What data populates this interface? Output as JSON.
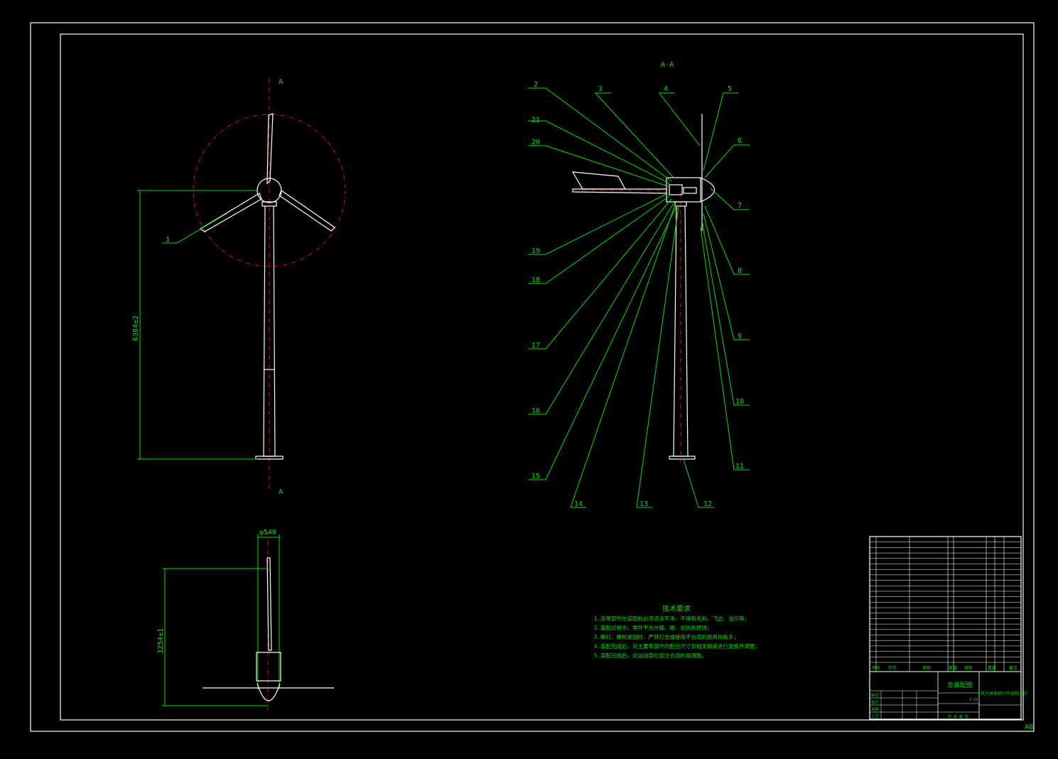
{
  "drawing": {
    "section_marker": "A",
    "section_title": "A-A",
    "sheet_size": "A0",
    "front_dim": "6384±2",
    "top_dim_diameter": "φ540",
    "top_dim_length": "3254±1",
    "front_callout": "1",
    "callouts_right": [
      "5",
      "6",
      "7",
      "8",
      "9",
      "10",
      "11"
    ],
    "callouts_left": [
      "2",
      "21",
      "20",
      "19",
      "18",
      "17",
      "16",
      "15"
    ],
    "callouts_top": [
      "3",
      "4"
    ],
    "callouts_bottom": [
      "14",
      "13",
      "12"
    ]
  },
  "notes": {
    "title": "技术要求",
    "lines": [
      "1.各零部件在装配前必须清洗干净，不得有毛刺、飞边、油污等；",
      "2.装配过程中，零件不允许磕、碰、划伤和锈蚀；",
      "3.螺钉、螺栓紧固时，严禁打击或使用不合适的旋具和扳手；",
      "4.装配完成后，对主要零部件的配合尺寸及相关精度进行复核并调整；",
      "5.装配完成后，对运动部位加注合适的润滑脂。"
    ]
  },
  "title_block": {
    "drawing_name": "总装配图",
    "project": "风力发电机叶片结构设计",
    "scale": "1:10",
    "col_no": "序号",
    "col_code": "代号",
    "col_name": "名称",
    "col_qty": "数量",
    "col_material": "材料",
    "col_weight": "重量",
    "col_note": "备注",
    "row_labels": [
      "标记",
      "设计",
      "审核",
      "工艺"
    ],
    "bottom_text": "共  张  第  张"
  }
}
